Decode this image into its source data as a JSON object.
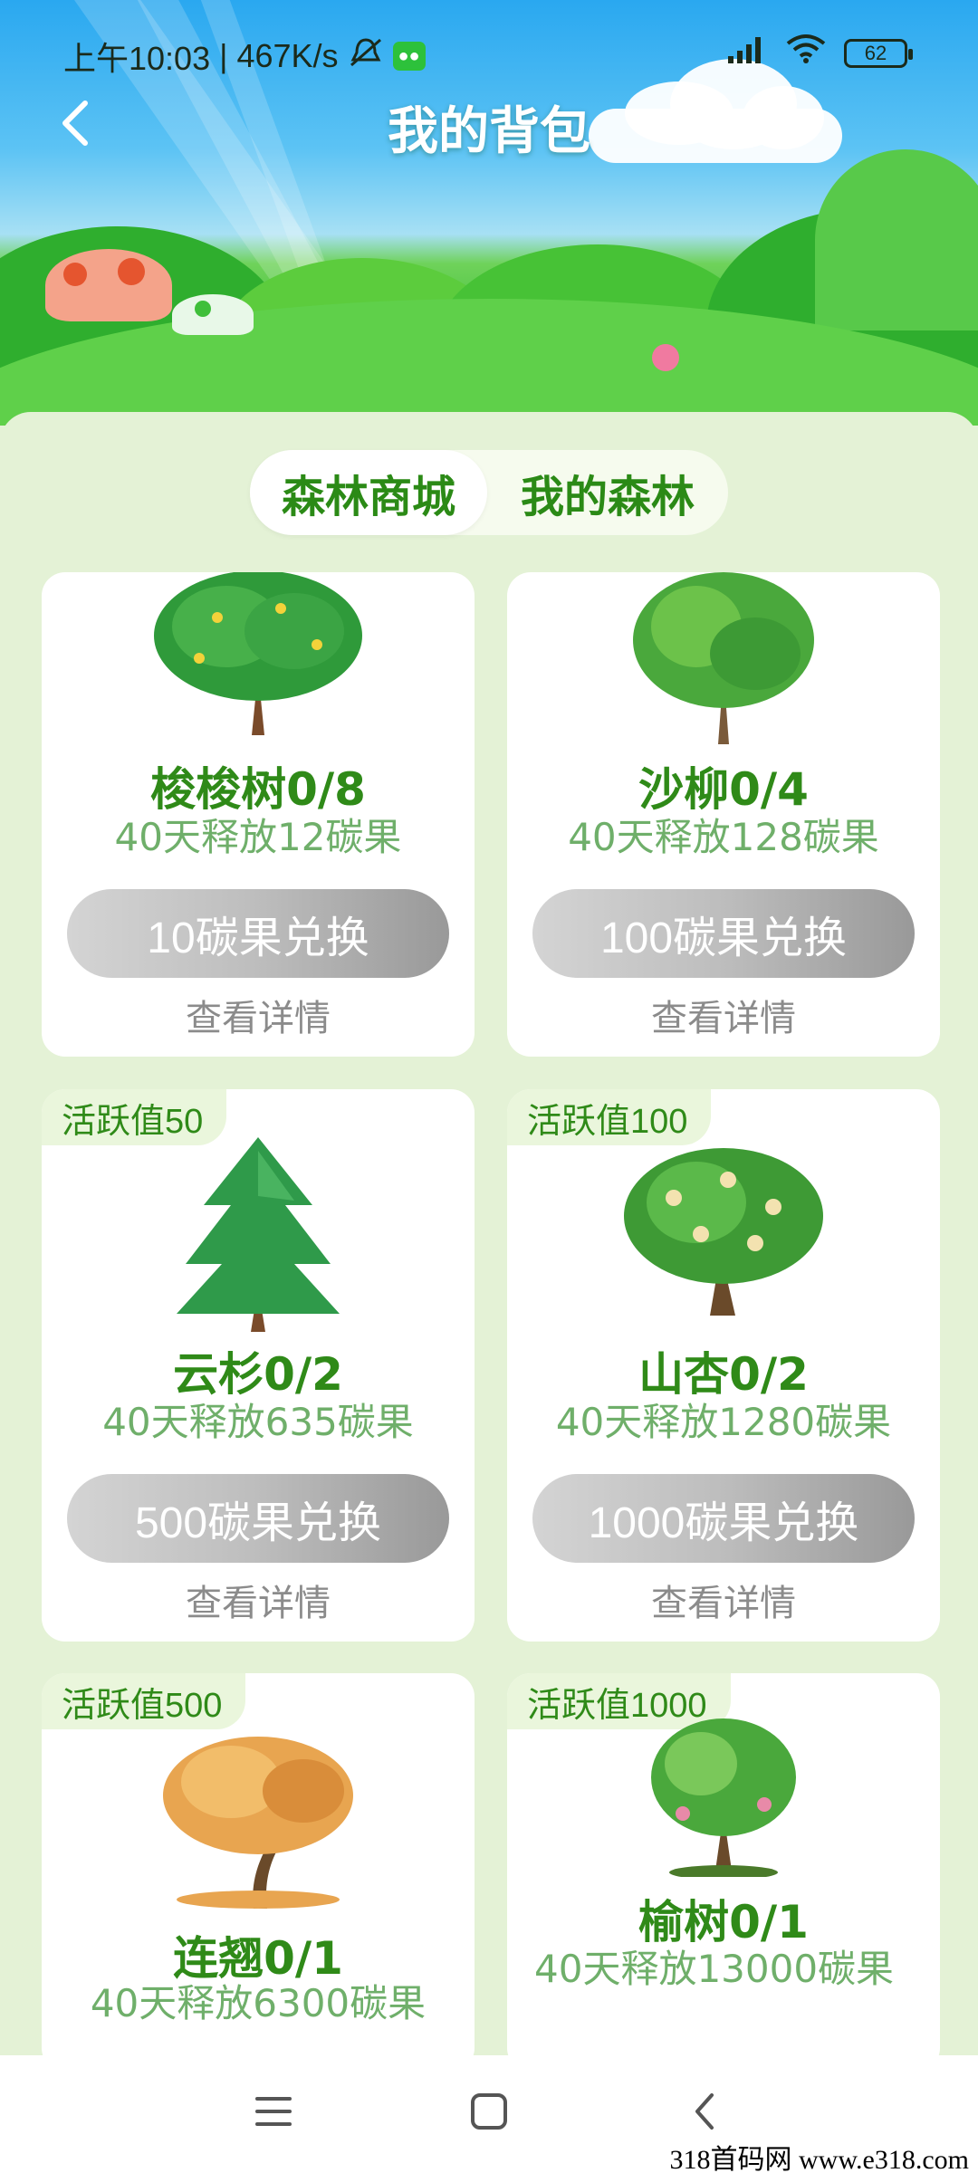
{
  "status_bar": {
    "time": "上午10:03",
    "net_speed": "467K/s",
    "battery": "62",
    "separator": "|"
  },
  "header": {
    "title": "我的背包"
  },
  "tabs": [
    {
      "label": "森林商城",
      "active": true
    },
    {
      "label": "我的森林",
      "active": false
    }
  ],
  "cards": [
    {
      "badge": "",
      "name": "梭梭树0/8",
      "desc": "40天释放12碳果",
      "button": "10碳果兑换",
      "link": "查看详情"
    },
    {
      "badge": "",
      "name": "沙柳0/4",
      "desc": "40天释放128碳果",
      "button": "100碳果兑换",
      "link": "查看详情"
    },
    {
      "badge": "活跃值50",
      "name": "云杉0/2",
      "desc": "40天释放635碳果",
      "button": "500碳果兑换",
      "link": "查看详情"
    },
    {
      "badge": "活跃值100",
      "name": "山杏0/2",
      "desc": "40天释放1280碳果",
      "button": "1000碳果兑换",
      "link": "查看详情"
    },
    {
      "badge": "活跃值500",
      "name": "连翘0/1",
      "desc": "40天释放6300碳果"
    },
    {
      "badge": "活跃值1000",
      "name": "榆树0/1",
      "desc": "40天释放13000碳果"
    }
  ],
  "watermark": "318首码网  www.e318.com",
  "colors": {
    "accent_green": "#2f8a18",
    "desc_green": "#6faf6a",
    "panel_bg": "#e4f2d6"
  },
  "icons": [
    "back-icon",
    "signal-icon",
    "wifi-icon",
    "mute-icon",
    "wechat-icon",
    "menu-icon",
    "home-icon",
    "nav-back-icon"
  ]
}
